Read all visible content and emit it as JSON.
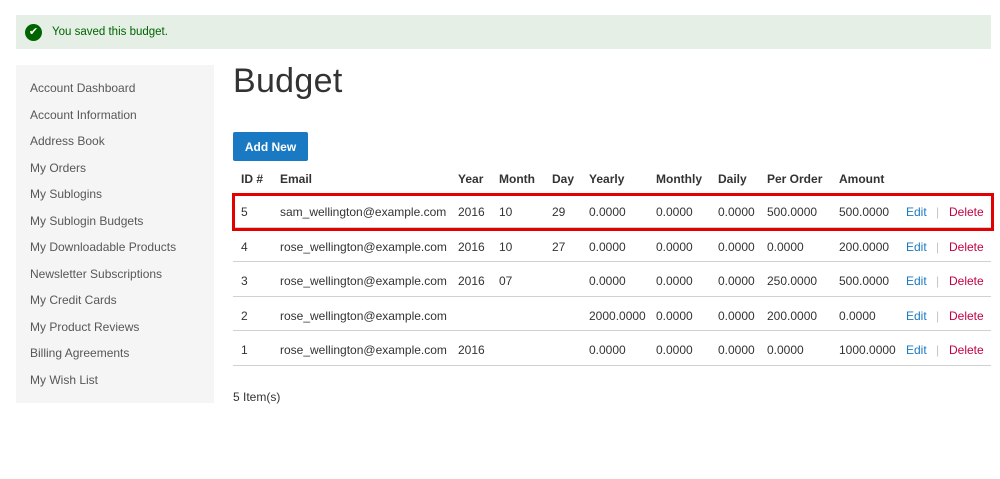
{
  "message": {
    "text": "You saved this budget.",
    "icon": "check-icon",
    "color": "#006400",
    "background": "#e5efe5"
  },
  "sidebar": {
    "items": [
      {
        "label": "Account Dashboard"
      },
      {
        "label": "Account Information"
      },
      {
        "label": "Address Book"
      },
      {
        "label": "My Orders"
      },
      {
        "label": "My Sublogins"
      },
      {
        "label": "My Sublogin Budgets"
      },
      {
        "label": "My Downloadable Products"
      },
      {
        "label": "Newsletter Subscriptions"
      },
      {
        "label": "My Credit Cards"
      },
      {
        "label": "My Product Reviews"
      },
      {
        "label": "Billing Agreements"
      },
      {
        "label": "My Wish List"
      }
    ]
  },
  "page": {
    "title": "Budget",
    "add_new_label": "Add New",
    "items_count": "5 Item(s)"
  },
  "table": {
    "headers": {
      "id": "ID #",
      "email": "Email",
      "year": "Year",
      "month": "Month",
      "day": "Day",
      "yearly": "Yearly",
      "monthly": "Monthly",
      "daily": "Daily",
      "per_order": "Per Order",
      "amount": "Amount"
    },
    "rows": [
      {
        "id": "5",
        "email": "sam_wellington@example.com",
        "year": "2016",
        "month": "10",
        "day": "29",
        "yearly": "0.0000",
        "monthly": "0.0000",
        "daily": "0.0000",
        "per_order": "500.0000",
        "amount": "500.0000",
        "edit": "Edit",
        "sep": "|",
        "delete": "Delete"
      },
      {
        "id": "4",
        "email": "rose_wellington@example.com",
        "year": "2016",
        "month": "10",
        "day": "27",
        "yearly": "0.0000",
        "monthly": "0.0000",
        "daily": "0.0000",
        "per_order": "0.0000",
        "amount": "200.0000",
        "edit": "Edit",
        "sep": "|",
        "delete": "Delete"
      },
      {
        "id": "3",
        "email": "rose_wellington@example.com",
        "year": "2016",
        "month": "07",
        "day": "",
        "yearly": "0.0000",
        "monthly": "0.0000",
        "daily": "0.0000",
        "per_order": "250.0000",
        "amount": "500.0000",
        "edit": "Edit",
        "sep": "|",
        "delete": "Delete"
      },
      {
        "id": "2",
        "email": "rose_wellington@example.com",
        "year": "",
        "month": "",
        "day": "",
        "yearly": "2000.0000",
        "monthly": "0.0000",
        "daily": "0.0000",
        "per_order": "200.0000",
        "amount": "0.0000",
        "edit": "Edit",
        "sep": "|",
        "delete": "Delete"
      },
      {
        "id": "1",
        "email": "rose_wellington@example.com",
        "year": "2016",
        "month": "",
        "day": "",
        "yearly": "0.0000",
        "monthly": "0.0000",
        "daily": "0.0000",
        "per_order": "0.0000",
        "amount": "1000.0000",
        "edit": "Edit",
        "sep": "|",
        "delete": "Delete"
      }
    ]
  },
  "colors": {
    "primary": "#1979c3",
    "delete": "#c30040",
    "highlight": "#e30000"
  }
}
